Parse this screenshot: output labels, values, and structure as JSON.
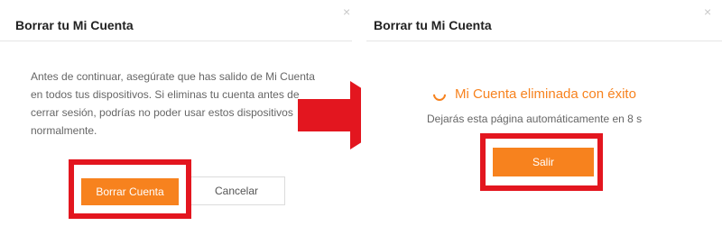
{
  "left_dialog": {
    "title": "Borrar tu Mi Cuenta",
    "close_glyph": "×",
    "message": "Antes de continuar, asegúrate que has salido de Mi Cuenta en todos tus dispositivos. Si eliminas tu cuenta antes de cerrar sesión, podrías no poder usar estos dispositivos normalmente.",
    "confirm_label": "Borrar Cuenta",
    "cancel_label": "Cancelar"
  },
  "right_dialog": {
    "title": "Borrar tu Mi Cuenta",
    "close_glyph": "×",
    "success_text": "Mi Cuenta eliminada con éxito",
    "leave_prefix": "Dejarás esta página automáticamente en",
    "countdown": "8 s",
    "exit_label": "Salir"
  },
  "colors": {
    "accent": "#f7821e",
    "highlight": "#e3161f",
    "arrow": "#e3161f"
  },
  "icons": {
    "close": "close-icon",
    "spinner": "spinner-icon",
    "arrow": "right-arrow-icon"
  }
}
